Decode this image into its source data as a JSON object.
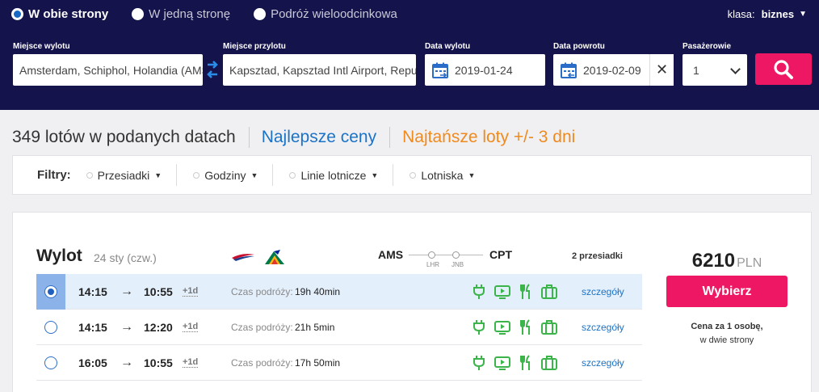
{
  "trip_types": [
    {
      "label": "W obie strony",
      "selected": true
    },
    {
      "label": "W jedną stronę",
      "selected": false
    },
    {
      "label": "Podróż wieloodcinkowa",
      "selected": false
    }
  ],
  "klasa": {
    "label": "klasa:",
    "value": "biznes"
  },
  "search": {
    "from_label": "Miejsce wylotu",
    "from_value": "Amsterdam, Schiphol, Holandia (AMS)",
    "to_label": "Miejsce przylotu",
    "to_value": "Kapsztad, Kapsztad Intl Airport, Republika Południowej Afryki (CPT)",
    "depart_label": "Data wylotu",
    "depart_value": "2019-01-24",
    "return_label": "Data powrotu",
    "return_value": "2019-02-09",
    "pax_label": "Pasażerowie",
    "pax_value": "1"
  },
  "results": {
    "count_text": "349 lotów w podanych datach",
    "best_prices": "Najlepsze ceny",
    "cheapest": "Najtańsze loty +/- 3 dni"
  },
  "filters": {
    "label": "Filtry:",
    "items": [
      "Przesiadki",
      "Godziny",
      "Linie lotnicze",
      "Lotniska"
    ]
  },
  "card": {
    "leg_title": "Wylot",
    "leg_date": "24 sty (czw.)",
    "origin": "AMS",
    "destination": "CPT",
    "stops": [
      "LHR",
      "JNB"
    ],
    "stops_count": "2 przesiadki",
    "price": "6210",
    "currency": "PLN",
    "select_label": "Wybierz",
    "price_note_1": "Cena za 1 osobę,",
    "price_note_2": "w dwie strony",
    "rows": [
      {
        "dep": "14:15",
        "arrow": "→",
        "arr": "10:55",
        "plus": "+1d",
        "dur_label": "Czas podróży:",
        "dur": "19h 40min",
        "details": "szczegóły",
        "selected": true
      },
      {
        "dep": "14:15",
        "arrow": "→",
        "arr": "12:20",
        "plus": "+1d",
        "dur_label": "Czas podróży:",
        "dur": "21h 5min",
        "details": "szczegóły",
        "selected": false
      },
      {
        "dep": "16:05",
        "arrow": "→",
        "arr": "10:55",
        "plus": "+1d",
        "dur_label": "Czas podróży:",
        "dur": "17h 50min",
        "details": "szczegóły",
        "selected": false
      }
    ],
    "amenity_icons": [
      "power-outlet-icon",
      "entertainment-screen-icon",
      "meal-icon",
      "baggage-icon"
    ]
  },
  "colors": {
    "header_bg": "#14134b",
    "accent_pink": "#ee1764",
    "link_blue": "#1a73c7",
    "link_orange": "#ef8a1e",
    "amenity_green": "#3bb54a"
  }
}
